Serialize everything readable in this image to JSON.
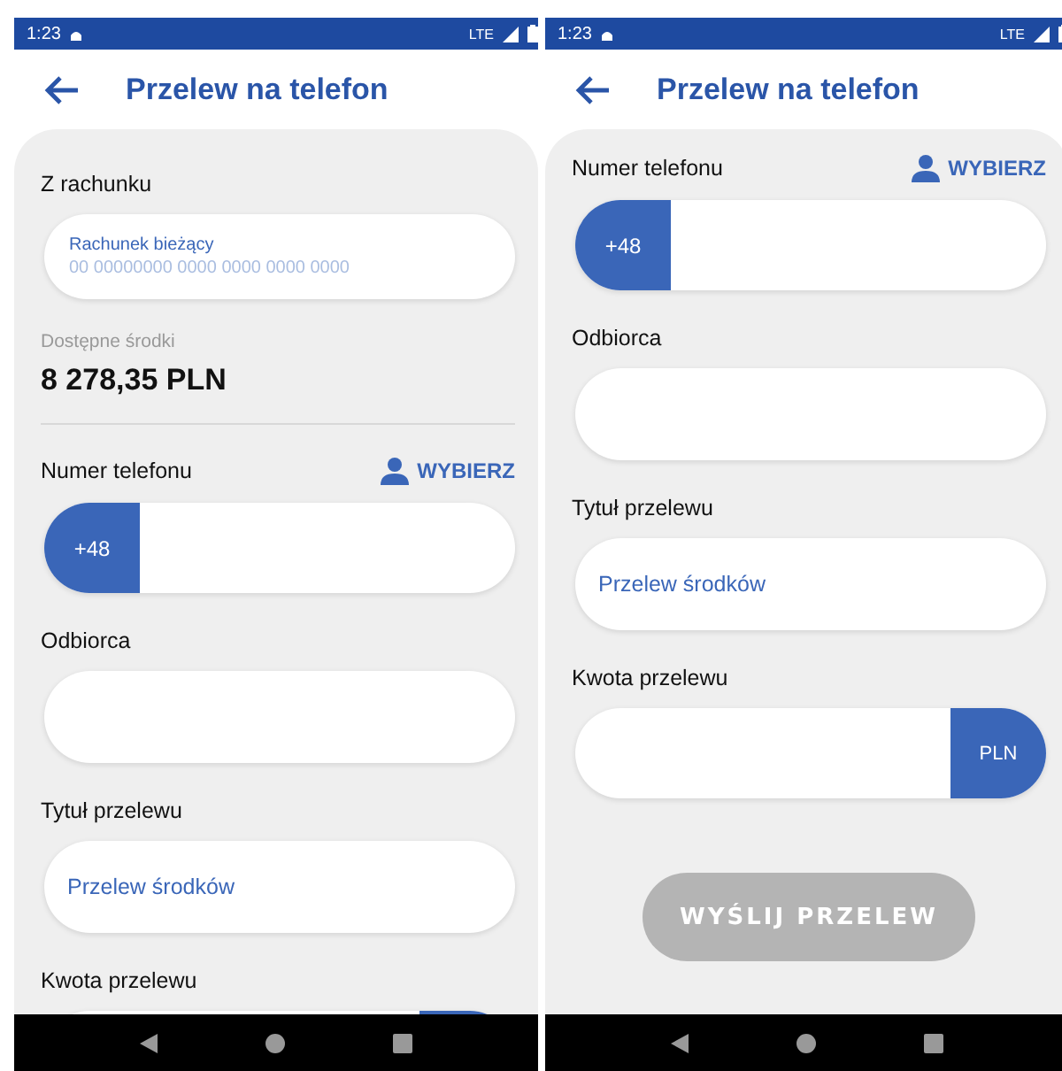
{
  "screens": [
    {
      "status_time": "1:23",
      "network": "LTE",
      "title": "Przelew na telefon",
      "items": [
        {
          "kind": "account",
          "label": "Z rachunku",
          "name": "Rachunek bieżący",
          "number": "00 00000000 0000 0000 0000 0000"
        },
        {
          "kind": "balance",
          "label": "Dostępne środki",
          "amount": "8 278,35 PLN"
        },
        {
          "kind": "phone",
          "label": "Numer telefonu",
          "action": "WYBIERZ",
          "prefix": "+48"
        },
        {
          "kind": "text",
          "label": "Odbiorca"
        },
        {
          "kind": "text",
          "label": "Tytuł przelewu",
          "value": "Przelew środków"
        },
        {
          "kind": "amount",
          "label": "Kwota przelewu"
        }
      ]
    },
    {
      "status_time": "1:23",
      "network": "LTE",
      "title": "Przelew na telefon",
      "items": [
        {
          "kind": "phone",
          "label": "Numer telefonu",
          "action": "WYBIERZ",
          "prefix": "+48"
        },
        {
          "kind": "text",
          "label": "Odbiorca"
        },
        {
          "kind": "text",
          "label": "Tytuł przelewu",
          "value": "Przelew środków"
        },
        {
          "kind": "amount",
          "label": "Kwota przelewu",
          "currency": "PLN"
        },
        {
          "kind": "submit",
          "label": "WYŚLIJ PRZELEW",
          "disabled": true
        }
      ]
    }
  ]
}
